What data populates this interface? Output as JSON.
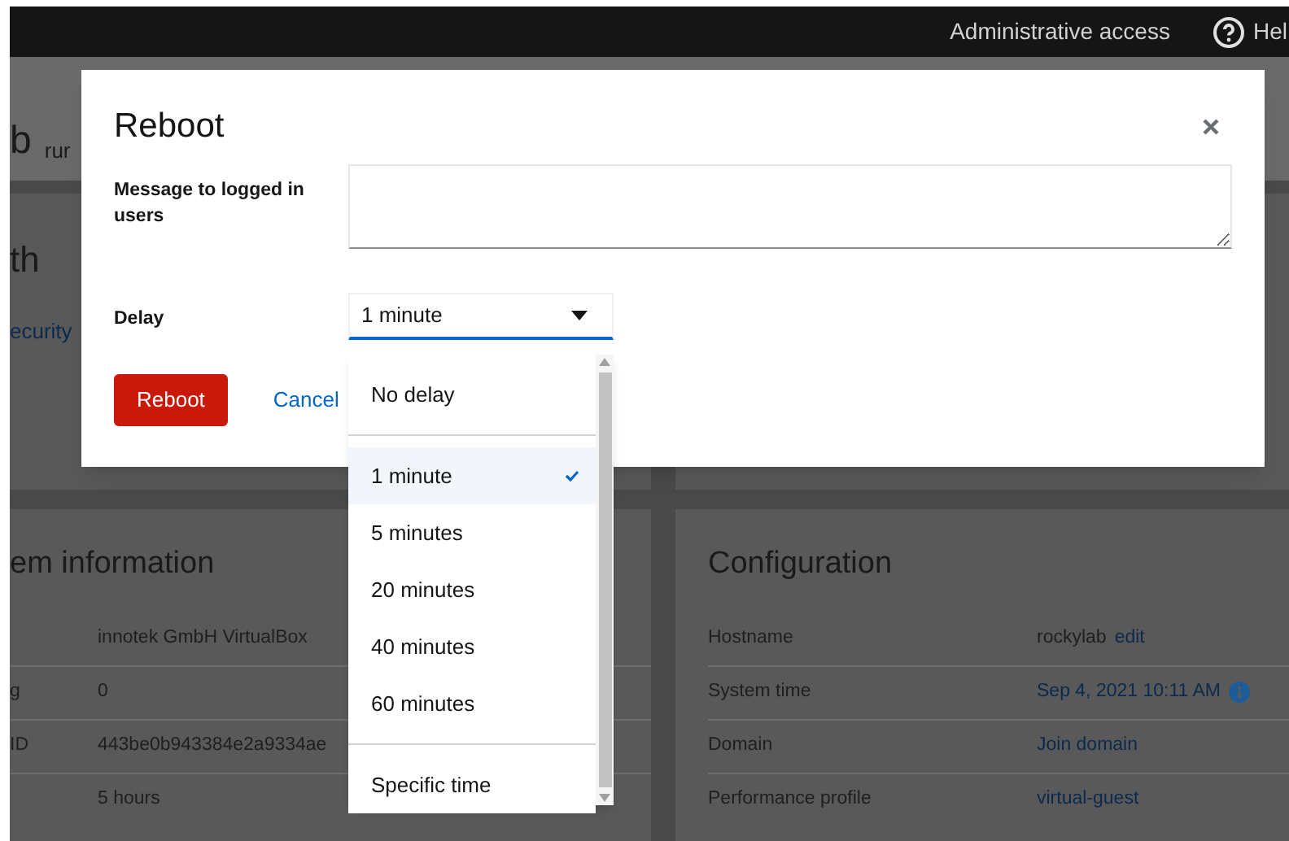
{
  "top_bar": {
    "items": [
      {
        "kind": "text",
        "label": "Administrative access"
      },
      {
        "kind": "help",
        "label": "Hel"
      }
    ]
  },
  "background": {
    "header": {
      "title": "b",
      "subtitle": "rur"
    },
    "upper_card": {
      "title": "th",
      "link": "ecurity"
    },
    "cards": [
      {
        "title": "em information",
        "rows": [
          {
            "value": "innotek GmbH VirtualBox"
          },
          {
            "label": "g",
            "value": "0"
          },
          {
            "label": "ID",
            "value": "443be0b943384e2a9334ae"
          },
          {
            "value": "5 hours"
          }
        ]
      },
      {
        "title": "Configuration",
        "rows": [
          {
            "label": "Hostname",
            "kind": "text_link",
            "value": "rockylab",
            "link": "edit"
          },
          {
            "label": "System time",
            "kind": "link_info",
            "link": "Sep 4, 2021 10:11 AM"
          },
          {
            "label": "Domain",
            "kind": "link",
            "link": "Join domain"
          },
          {
            "label": "Performance profile",
            "kind": "link",
            "link": "virtual-guest"
          }
        ]
      }
    ]
  },
  "dialog": {
    "title": "Reboot",
    "message_label": "Message to logged in users",
    "delay_label": "Delay",
    "delay_value": "1 minute",
    "delay_options": [
      [
        {
          "label": "No delay",
          "selected": false
        }
      ],
      [
        {
          "label": "1 minute",
          "selected": true
        },
        {
          "label": "5 minutes",
          "selected": false
        },
        {
          "label": "20 minutes",
          "selected": false
        },
        {
          "label": "40 minutes",
          "selected": false
        },
        {
          "label": "60 minutes",
          "selected": false
        }
      ],
      [
        {
          "label": "Specific time",
          "selected": false
        }
      ]
    ],
    "buttons": [
      {
        "kind": "primary",
        "label": "Reboot"
      },
      {
        "kind": "link",
        "label": "Cancel"
      }
    ]
  }
}
